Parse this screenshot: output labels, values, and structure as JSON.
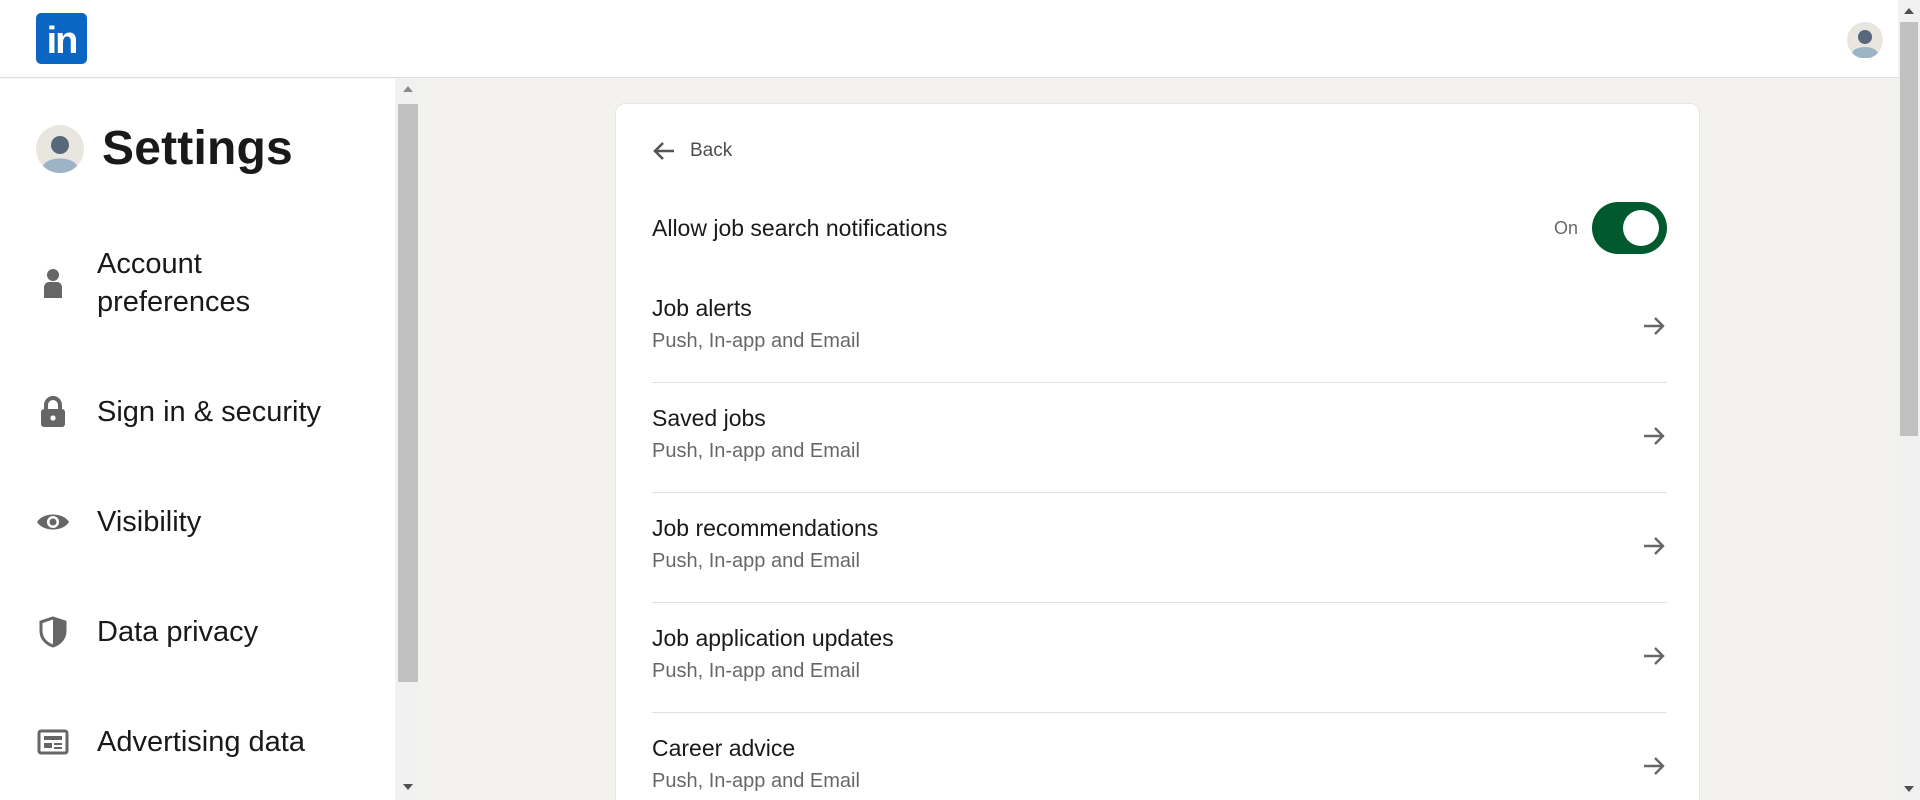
{
  "header": {
    "logo_text": "in",
    "brand_color": "#0a66c2"
  },
  "sidebar": {
    "title": "Settings",
    "items": [
      {
        "label": "Account\npreferences",
        "icon": "person-icon"
      },
      {
        "label": "Sign in & security",
        "icon": "lock-icon"
      },
      {
        "label": "Visibility",
        "icon": "eye-icon"
      },
      {
        "label": "Data privacy",
        "icon": "shield-icon"
      },
      {
        "label": "Advertising data",
        "icon": "newspaper-icon"
      }
    ]
  },
  "main": {
    "back_label": "Back",
    "toggle": {
      "label": "Allow job search notifications",
      "state_label": "On",
      "color": "#01592e"
    },
    "items": [
      {
        "title": "Job alerts",
        "subtitle": "Push, In-app and Email"
      },
      {
        "title": "Saved jobs",
        "subtitle": "Push, In-app and Email"
      },
      {
        "title": "Job recommendations",
        "subtitle": "Push, In-app and Email"
      },
      {
        "title": "Job application updates",
        "subtitle": "Push, In-app and Email"
      },
      {
        "title": "Career advice",
        "subtitle": "Push, In-app and Email"
      }
    ]
  }
}
